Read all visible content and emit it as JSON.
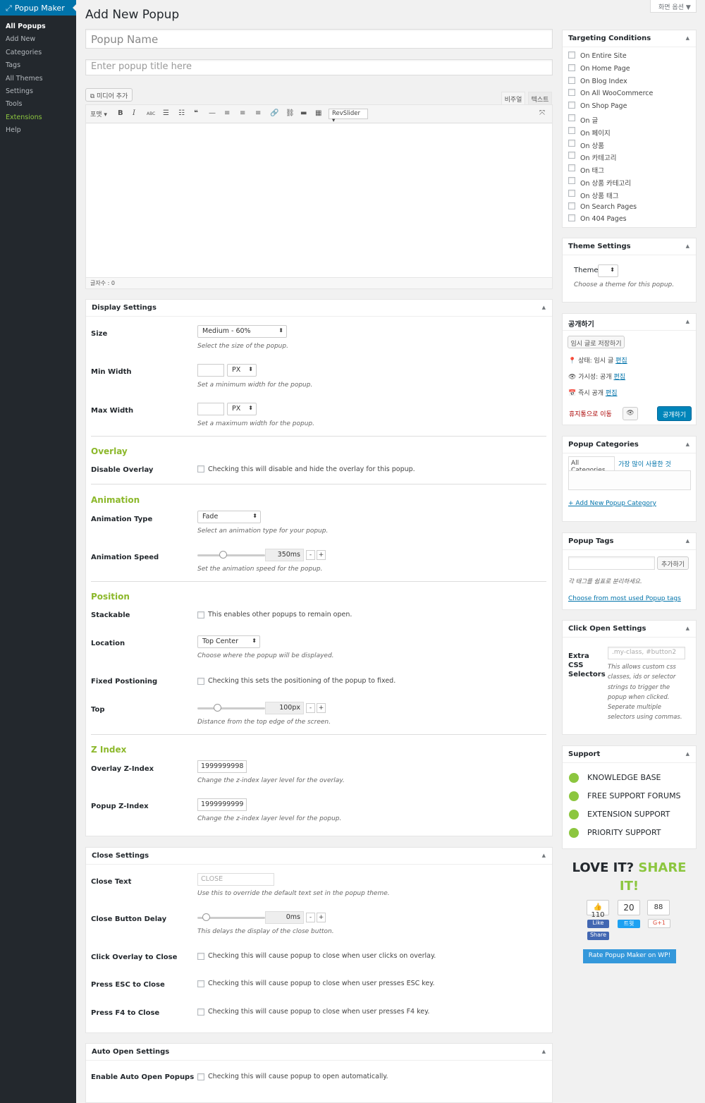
{
  "sidebar": {
    "brand": "Popup Maker",
    "items": [
      {
        "label": "All Popups"
      },
      {
        "label": "Add New"
      },
      {
        "label": "Categories"
      },
      {
        "label": "Tags"
      },
      {
        "label": "All Themes"
      },
      {
        "label": "Settings"
      },
      {
        "label": "Tools"
      },
      {
        "label": "Extensions"
      },
      {
        "label": "Help"
      }
    ]
  },
  "header": {
    "title": "Add New Popup",
    "screen_options": "화면 옵션 ▼"
  },
  "form": {
    "popup_name_placeholder": "Popup Name",
    "popup_title_placeholder": "Enter popup title here"
  },
  "editor": {
    "add_media": "미디어 추가",
    "tab_visual": "비주얼",
    "tab_text": "텍스트",
    "format": "포맷 ▾",
    "revslider": "RevSlider ▾",
    "word_count": "글자수 : 0"
  },
  "display": {
    "title": "Display Settings",
    "size_label": "Size",
    "size_value": "Medium - 60%",
    "size_desc": "Select the size of the popup.",
    "min_label": "Min Width",
    "min_unit": "PX",
    "min_desc": "Set a minimum width for the popup.",
    "max_label": "Max Width",
    "max_unit": "PX",
    "max_desc": "Set a maximum width for the popup.",
    "overlay_title": "Overlay",
    "disable_overlay_label": "Disable Overlay",
    "disable_overlay_text": "Checking this will disable and hide the overlay for this popup.",
    "animation_title": "Animation",
    "anim_type_label": "Animation Type",
    "anim_type_value": "Fade",
    "anim_type_desc": "Select an animation type for your popup.",
    "anim_speed_label": "Animation Speed",
    "anim_speed_value": "350ms",
    "anim_speed_fraction": 0.35,
    "anim_speed_desc": "Set the animation speed for the popup.",
    "position_title": "Position",
    "stackable_label": "Stackable",
    "stackable_text": "This enables other popups to remain open.",
    "location_label": "Location",
    "location_value": "Top Center",
    "location_desc": "Choose where the popup will be displayed.",
    "fixed_label": "Fixed Postioning",
    "fixed_text": "Checking this sets the positioning of the popup to fixed.",
    "top_label": "Top",
    "top_value": "100px",
    "top_fraction": 0.25,
    "top_desc": "Distance from the top edge of the screen.",
    "zindex_title": "Z Index",
    "overlay_z_label": "Overlay Z-Index",
    "overlay_z_value": "1999999998",
    "overlay_z_desc": "Change the z-index layer level for the overlay.",
    "popup_z_label": "Popup Z-Index",
    "popup_z_value": "1999999999",
    "popup_z_desc": "Change the z-index layer level for the popup."
  },
  "close": {
    "title": "Close Settings",
    "text_label": "Close Text",
    "text_placeholder": "CLOSE",
    "text_desc": "Use this to override the default text set in the popup theme.",
    "delay_label": "Close Button Delay",
    "delay_value": "0ms",
    "delay_fraction": 0.08,
    "delay_desc": "This delays the display of the close button.",
    "overlay_label": "Click Overlay to Close",
    "overlay_text": "Checking this will cause popup to close when user clicks on overlay.",
    "esc_label": "Press ESC to Close",
    "esc_text": "Checking this will cause popup to close when user presses ESC key.",
    "f4_label": "Press F4 to Close",
    "f4_text": "Checking this will cause popup to close when user presses F4 key."
  },
  "auto": {
    "title": "Auto Open Settings",
    "enable_label": "Enable Auto Open Popups",
    "enable_text": "Checking this will cause popup to open automatically."
  },
  "targeting": {
    "title": "Targeting Conditions",
    "items": [
      "On Entire Site",
      "On Home Page",
      "On Blog Index",
      "On All WooCommerce",
      "On Shop Page",
      "On 글",
      "On 페이지",
      "On 상품",
      "On 카테고리",
      "On 태그",
      "On 상품 카테고리",
      "On 상품 태그",
      "On Search Pages",
      "On 404 Pages"
    ]
  },
  "theme": {
    "title": "Theme Settings",
    "label": "Theme",
    "desc": "Choose a theme for this popup."
  },
  "publish": {
    "title": "공개하기",
    "save_draft": "임시 글로 저장하기",
    "status": "상태: 임시 글",
    "visibility": "가시성: 공개",
    "schedule": "즉시 공개",
    "edit": "편집",
    "trash": "휴지통으로 이동",
    "publish_btn": "공개하기"
  },
  "categories": {
    "title": "Popup Categories",
    "tab_all": "All Categories",
    "tab_popular": "가장 많이 사용한 것",
    "add_new": "+ Add New Popup Category"
  },
  "tags": {
    "title": "Popup Tags",
    "add": "추가하기",
    "hint": "각 태그를 쉼표로 분리하세요.",
    "choose": "Choose from most used Popup tags"
  },
  "click_open": {
    "title": "Click Open Settings",
    "label": "Extra CSS Selectors",
    "placeholder": ".my-class, #button2",
    "desc": "This allows custom css classes, ids or selector strings to trigger the popup when clicked. Seperate multiple selectors using commas."
  },
  "support": {
    "title": "Support",
    "items": [
      "KNOWLEDGE BASE",
      "FREE SUPPORT FORUMS",
      "EXTENSION SUPPORT",
      "PRIORITY SUPPORT"
    ]
  },
  "share": {
    "love": "LOVE IT?",
    "share": "SHARE IT!",
    "fb_count": "110",
    "tw_count": "20",
    "gp_count": "88",
    "fb_like": "Like",
    "fb_share": "Share",
    "tw_label": "트윗",
    "gp_label": "G+1",
    "rate": "Rate Popup Maker on WP!"
  },
  "colors": {
    "accent": "#8cb82b",
    "primary": "#0073aa",
    "sidebar": "#23282d"
  },
  "toggle_icon": "▲"
}
